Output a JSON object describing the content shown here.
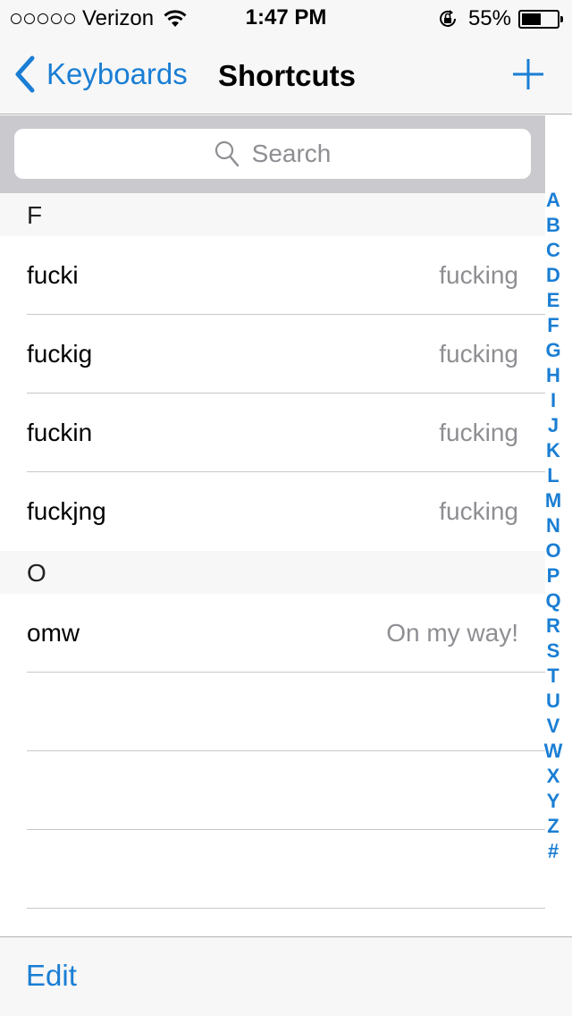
{
  "status_bar": {
    "carrier": "Verizon",
    "signal_dots": 5,
    "time": "1:47 PM",
    "battery_percent_label": "55%",
    "battery_level": 0.55
  },
  "nav": {
    "back_label": "Keyboards",
    "title": "Shortcuts",
    "add_icon": "plus-icon"
  },
  "search": {
    "placeholder": "Search"
  },
  "sections": [
    {
      "header": "F",
      "rows": [
        {
          "shortcut": "fucki",
          "phrase": "fucking"
        },
        {
          "shortcut": "fuckig",
          "phrase": "fucking"
        },
        {
          "shortcut": "fuckin",
          "phrase": "fucking"
        },
        {
          "shortcut": "fuckjng",
          "phrase": "fucking"
        }
      ]
    },
    {
      "header": "O",
      "rows": [
        {
          "shortcut": "omw",
          "phrase": "On my way!"
        }
      ]
    }
  ],
  "index": [
    "A",
    "B",
    "C",
    "D",
    "E",
    "F",
    "G",
    "H",
    "I",
    "J",
    "K",
    "L",
    "M",
    "N",
    "O",
    "P",
    "Q",
    "R",
    "S",
    "T",
    "U",
    "V",
    "W",
    "X",
    "Y",
    "Z",
    "#"
  ],
  "toolbar": {
    "edit_label": "Edit"
  },
  "colors": {
    "accent": "#1a7ed4",
    "secondary_text": "#8e8e93",
    "search_bg": "#c9c9ce"
  }
}
